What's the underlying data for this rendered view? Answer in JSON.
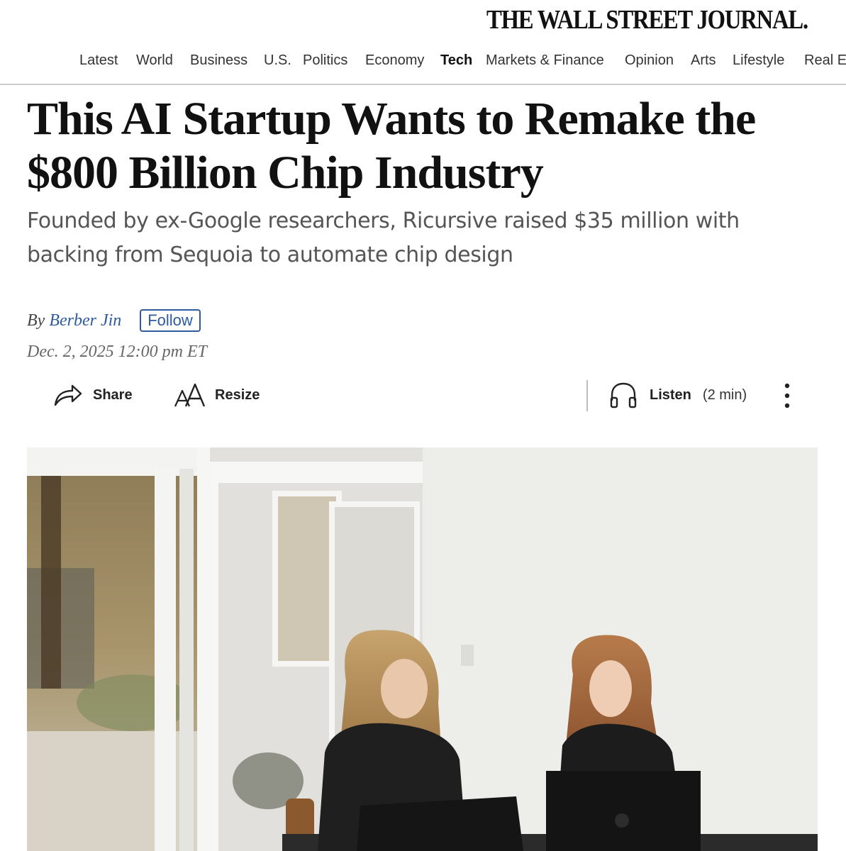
{
  "masthead": {
    "title": "THE WALL STREET JOURNAL."
  },
  "nav": {
    "items": [
      "Latest",
      "World",
      "Business",
      "U.S.",
      "Politics",
      "Economy",
      "Tech",
      "Markets & Finance",
      "Opinion",
      "Arts",
      "Lifestyle",
      "Real E"
    ],
    "active": "Tech"
  },
  "article": {
    "headline_line1": "This AI Startup Wants to Remake the",
    "headline_line2": "$800 Billion Chip Industry",
    "dek_line1": "Founded by ex-Google researchers, Ricursive raised $35 million with",
    "dek_line2": "backing from Sequoia to automate chip design",
    "byline_prefix": "By",
    "author": "Berber Jin",
    "follow_label": "Follow",
    "date": "Dec. 2, 2025 12:00 pm ET"
  },
  "toolbar": {
    "share_label": "Share",
    "resize_label": "Resize",
    "listen_label": "Listen",
    "listen_duration": "(2 min)",
    "icons": {
      "share": "share-arrow-icon",
      "resize": "text-resize-icon",
      "listen": "headphones-icon",
      "more": "more-vertical-icon"
    }
  },
  "colors": {
    "link": "#2d5aa0",
    "text": "#121212",
    "dek": "#555555",
    "nav_border": "#cfcfcf"
  }
}
